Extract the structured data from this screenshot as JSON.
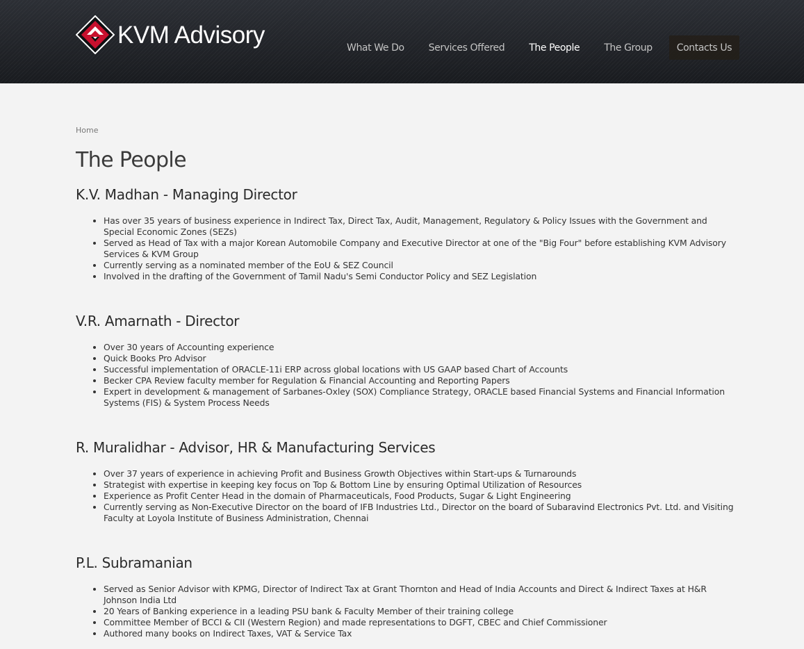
{
  "site": {
    "logo_text": "KVM Advisory",
    "logo_colors": {
      "diamond": "#c8102e",
      "outline": "#ffffff"
    },
    "logo_icon": "kvm-diamond-logo"
  },
  "nav": {
    "items": [
      {
        "label": "What We Do"
      },
      {
        "label": "Services Offered"
      },
      {
        "label": "The People"
      },
      {
        "label": "The Group"
      },
      {
        "label": "Contacts Us"
      }
    ],
    "active": "The People"
  },
  "breadcrumb": {
    "home": "Home"
  },
  "page": {
    "title": "The People"
  },
  "people": [
    {
      "name": "K.V. Madhan - Managing Director",
      "points": [
        "Has over 35 years of business experience in Indirect Tax, Direct Tax, Audit, Management, Regulatory & Policy Issues with the Government and Special Economic Zones (SEZs)",
        "Served as Head of Tax with a major Korean Automobile Company and Executive Director at one of the \"Big Four\" before establishing KVM Advisory Services & KVM Group",
        "Currently serving as a nominated member of the EoU & SEZ Council",
        "Involved in the drafting of the Government of Tamil Nadu's Semi Conductor Policy and SEZ Legislation"
      ]
    },
    {
      "name": "V.R. Amarnath - Director",
      "points": [
        "Over 30 years of Accounting experience",
        "Quick Books Pro Advisor",
        "Successful implementation of ORACLE-11i ERP across global locations with US GAAP based Chart of Accounts",
        "Becker CPA Review faculty member for Regulation & Financial Accounting and Reporting Papers",
        "Expert in development & management of Sarbanes-Oxley (SOX) Compliance Strategy, ORACLE based Financial Systems and Financial Information Systems (FIS) & System Process Needs"
      ]
    },
    {
      "name": "R. Muralidhar - Advisor, HR & Manufacturing Services",
      "points": [
        "Over 37 years of experience in achieving Profit and Business Growth Objectives within Start-ups & Turnarounds",
        "Strategist with expertise in keeping key focus on Top & Bottom Line by ensuring Optimal Utilization of Resources",
        "Experience as Profit Center Head in the domain of Pharmaceuticals, Food Products, Sugar & Light Engineering",
        "Currently serving as Non-Executive Director on the board of IFB Industries Ltd., Director on the board of Subaravind Electronics Pvt. Ltd. and Visiting Faculty at Loyola Institute of Business Administration, Chennai"
      ]
    },
    {
      "name": "P.L. Subramanian",
      "points": [
        "Served as Senior Advisor with KPMG, Director of Indirect Tax at Grant Thornton and Head of India Accounts and Direct & Indirect Taxes at H&R Johnson India Ltd",
        "20 Years of Banking experience in a leading PSU bank & Faculty Member of their training college",
        "Committee Member of BCCI & CII (Western Region) and made representations to DGFT, CBEC and Chief Commissioner",
        "Authored many books on Indirect Taxes, VAT & Service Tax"
      ]
    }
  ]
}
